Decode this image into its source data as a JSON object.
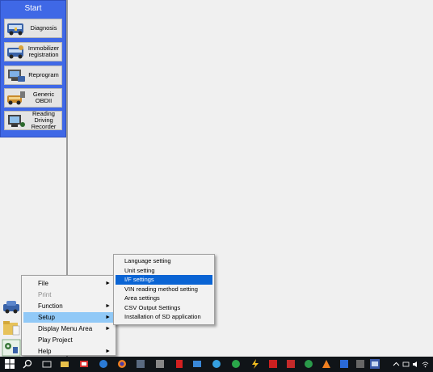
{
  "start_panel": {
    "title": "Start",
    "buttons": [
      {
        "label": "Diagnosis",
        "icon": "car-diagnosis-icon"
      },
      {
        "label": "Immobilizer registration",
        "icon": "immobilizer-icon"
      },
      {
        "label": "Reprogram",
        "icon": "reprogram-icon"
      },
      {
        "label": "Generic OBDII",
        "icon": "obd-icon"
      },
      {
        "label": "Reading Driving Recorder",
        "icon": "recorder-icon"
      }
    ]
  },
  "context_menu": {
    "items": [
      {
        "label": "File",
        "has_submenu": true,
        "enabled": true
      },
      {
        "label": "Print",
        "has_submenu": false,
        "enabled": false
      },
      {
        "label": "Function",
        "has_submenu": true,
        "enabled": true
      },
      {
        "label": "Setup",
        "has_submenu": true,
        "enabled": true,
        "active": true
      },
      {
        "label": "Display Menu Area",
        "has_submenu": true,
        "enabled": true
      },
      {
        "label": "Play Project",
        "has_submenu": false,
        "enabled": true
      },
      {
        "label": "Help",
        "has_submenu": true,
        "enabled": true
      }
    ]
  },
  "setup_submenu": {
    "items": [
      {
        "label": "Language setting"
      },
      {
        "label": "Unit setting"
      },
      {
        "label": "I/F settings",
        "selected": true
      },
      {
        "label": "VIN reading method setting"
      },
      {
        "label": "Area settings"
      },
      {
        "label": "CSV Output Settings"
      },
      {
        "label": "Installation of SD application"
      }
    ]
  },
  "taskbar": {
    "icons": [
      "windows-start-icon",
      "search-icon",
      "task-view-icon",
      "folder-icon",
      "mail-icon",
      "edge-icon",
      "firefox-icon",
      "app-icon",
      "app-icon",
      "pdf-icon",
      "media-icon",
      "chat-icon",
      "store-icon",
      "zap-icon",
      "app-icon",
      "app-icon",
      "app-icon",
      "vlc-icon",
      "app-icon",
      "app-icon",
      "active-app-icon"
    ],
    "tray": [
      "chevron-up-icon",
      "network-icon",
      "volume-icon",
      "wifi-icon"
    ]
  },
  "colors": {
    "start_panel_bg": "#3f68e6",
    "selection_blue": "#0a64d4",
    "menu_highlight": "#91c9f7",
    "taskbar_bg": "#101418"
  }
}
